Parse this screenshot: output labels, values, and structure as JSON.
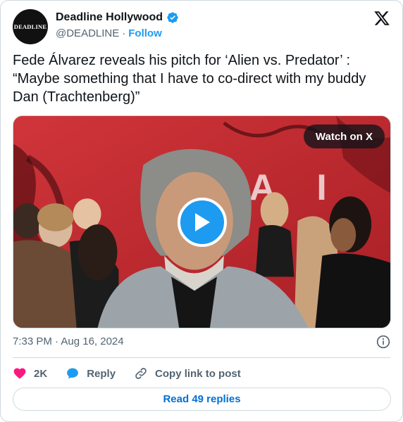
{
  "author": {
    "display_name": "Deadline Hollywood",
    "handle": "@DEADLINE",
    "separator": "·",
    "follow_label": "Follow",
    "avatar_text": "DEADLINE",
    "verified_color": "#1d9bf0"
  },
  "tweet": {
    "text": "Fede Álvarez reveals his pitch for ‘Alien vs. Predator’ : “Maybe something that I have to co-direct with my buddy Dan (Trachtenberg)”"
  },
  "media": {
    "watch_label": "Watch on X",
    "backdrop_letters": "A L I",
    "play_color": "#1d9bf0"
  },
  "meta": {
    "timestamp": "7:33 PM · Aug 16, 2024"
  },
  "actions": {
    "like_count": "2K",
    "reply_label": "Reply",
    "copy_label": "Copy link to post",
    "like_color": "#f91880",
    "reply_color": "#1d9bf0"
  },
  "footer": {
    "read_replies_label": "Read 49 replies"
  }
}
